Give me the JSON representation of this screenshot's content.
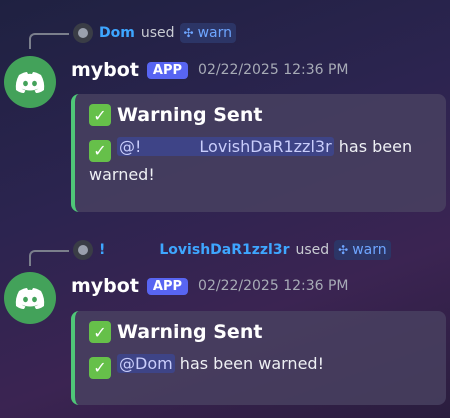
{
  "messages": [
    {
      "command_user": "Dom",
      "used_text": "used",
      "command": "warn",
      "bot_name": "mybot",
      "badge": "APP",
      "timestamp": "02/22/2025 12:36 PM",
      "embed_title": "Warning Sent",
      "embed_mention": "@!",
      "embed_mention_name": "LovishDaR1zzl3r",
      "embed_text": "has been warned!"
    },
    {
      "command_user_prefix": "!",
      "command_user": "LovishDaR1zzl3r",
      "used_text": "used",
      "command": "warn",
      "bot_name": "mybot",
      "badge": "APP",
      "timestamp": "02/22/2025 12:36 PM",
      "embed_title": "Warning Sent",
      "embed_mention": "@Dom",
      "embed_text": "has been warned!"
    }
  ],
  "colors": {
    "accent": "#5865f2",
    "embed_bar": "#4fc778",
    "link": "#3ea6ff",
    "avatar": "#43a25a"
  },
  "icons": {
    "bot_avatar": "discord-logo-icon",
    "command": "apps-icon",
    "check": "check-mark-icon"
  }
}
